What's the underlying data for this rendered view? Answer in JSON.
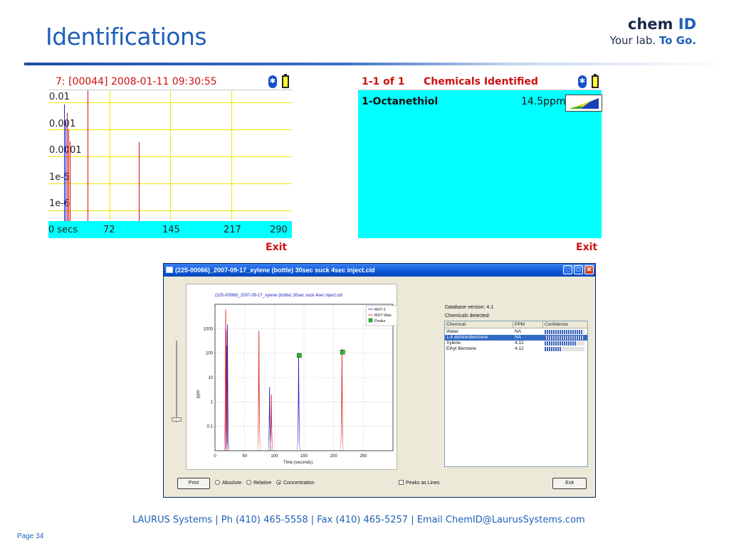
{
  "slide": {
    "title": "Identifications",
    "page_number": "Page 34",
    "footer": "LAURUS Systems  |  Ph (410) 465-5558  |  Fax (410) 465-5257  |  Email  ChemID@LaurusSystems.com"
  },
  "logo": {
    "main": "chem",
    "accent": "ID",
    "tagline": "Your lab.",
    "tagline_accent": "To Go."
  },
  "colors": {
    "brand_blue": "#1f5fb8",
    "device_red": "#d01010",
    "device_cyan": "#00ffff",
    "grid_yellow": "#f2e400"
  },
  "device_left": {
    "header": "7: [00044] 2008-01-11 09:30:55",
    "y_labels": [
      "0.01",
      "0.001",
      "0.0001",
      "1e-5",
      "1e-6"
    ],
    "x_labels": [
      "0 secs",
      "72",
      "145",
      "217",
      "290"
    ],
    "exit": "Exit",
    "icons": [
      "bluetooth-icon",
      "battery-icon"
    ]
  },
  "device_right": {
    "header_count": "1-1 of 1",
    "header_title": "Chemicals Identified",
    "chemical": "1-Octanethiol",
    "ppm": "14.5ppm",
    "exit": "Exit"
  },
  "app_window": {
    "title": "(225-00066)_2007-09-17_xylene (bottle) 30sec suck 4sec inject.cid",
    "database_version": "Database version: 4.1",
    "chemicals_detected": "Chemicals detected:",
    "columns": [
      "Chemical",
      "PPM",
      "Confidence"
    ],
    "rows": [
      {
        "chemical": "Water",
        "ppm": "NA",
        "confidence": 0.97,
        "selected": false
      },
      {
        "chemical": "1,4 dichlorobenzene",
        "ppm": "NA",
        "confidence": 1.0,
        "selected": true
      },
      {
        "chemical": "Xylene",
        "ppm": "4.12",
        "confidence": 0.8,
        "selected": false
      },
      {
        "chemical": "Ethyl Benzene",
        "ppm": "4.12",
        "confidence": 0.42,
        "selected": false
      }
    ],
    "buttons": {
      "print": "Print",
      "exit": "Exit"
    },
    "radios": [
      {
        "label": "Absolute",
        "checked": false
      },
      {
        "label": "Relative",
        "checked": false
      },
      {
        "label": "Concentration",
        "checked": true
      }
    ],
    "checkbox_label": "Peaks as Lines"
  },
  "chart_data": {
    "type": "line",
    "title": "(225-00066)_2007-09-17_xylene (bottle) 30sec suck 4sec inject.cid",
    "xlabel": "Time (seconds)",
    "ylabel": "ppm",
    "log_scale_y": true,
    "xlim": [
      0,
      300
    ],
    "ylim": [
      0.01,
      10000
    ],
    "x_ticks": [
      "0",
      "50",
      "100",
      "150",
      "200",
      "250"
    ],
    "y_ticks": [
      "1000",
      "100",
      "10",
      "1",
      "0.1"
    ],
    "grid": true,
    "legend": "top-right",
    "series": [
      {
        "name": "MXT-1",
        "color": "#2020d0",
        "peaks": [
          {
            "x": 20,
            "y": 200
          },
          {
            "x": 21,
            "y": 1500
          },
          {
            "x": 92,
            "y": 4
          },
          {
            "x": 141,
            "y": 80
          }
        ]
      },
      {
        "name": "MXT-Wax",
        "color": "#e02020",
        "peaks": [
          {
            "x": 18,
            "y": 6000
          },
          {
            "x": 19,
            "y": 900
          },
          {
            "x": 74,
            "y": 800
          },
          {
            "x": 95,
            "y": 2
          },
          {
            "x": 214,
            "y": 150
          }
        ]
      },
      {
        "name": "Peaks",
        "color": "#20c020",
        "markers": [
          {
            "x": 142,
            "y": 80
          },
          {
            "x": 215,
            "y": 110
          }
        ]
      }
    ]
  }
}
